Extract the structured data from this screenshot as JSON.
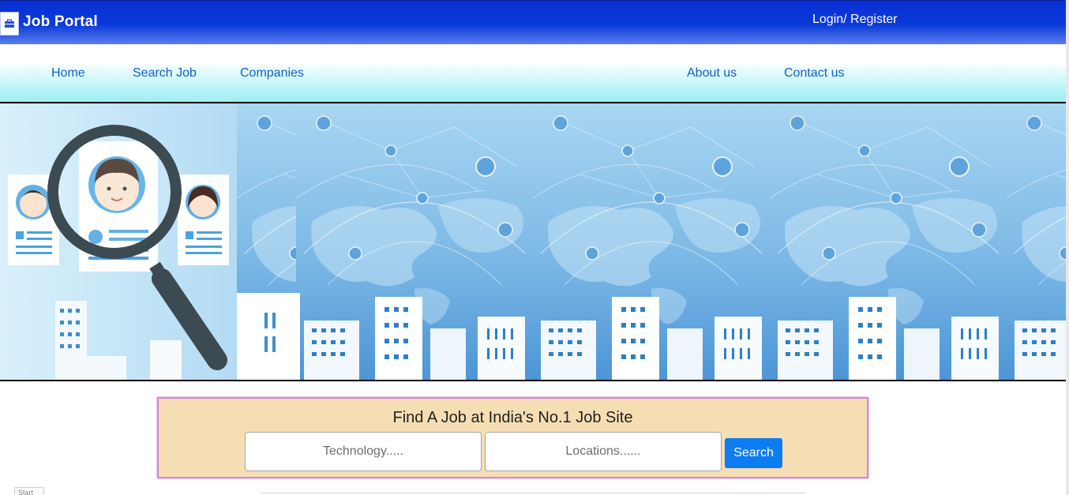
{
  "header": {
    "brand": "Job Portal",
    "login_label": "Login/ Register",
    "logo_icon": "briefcase-icon",
    "background_color": "#0a2fd6"
  },
  "nav": {
    "items": [
      {
        "label": "Home"
      },
      {
        "label": "Search Job"
      },
      {
        "label": "Companies"
      },
      {
        "label": "About us"
      },
      {
        "label": "Contact us"
      }
    ],
    "link_color": "#0b63c7",
    "background_color": "#b5f3f7"
  },
  "banner": {
    "image": "job-search-world-network-illustration"
  },
  "search": {
    "title": "Find A Job at India's No.1 Job Site",
    "technology_placeholder": "Technology.....",
    "technology_value": "",
    "location_placeholder": "Locations......",
    "location_value": "",
    "button_label": "Search",
    "card_color": "#f5deb3",
    "button_color": "#0d7cf2"
  },
  "footer": {
    "start_label": "Start"
  }
}
